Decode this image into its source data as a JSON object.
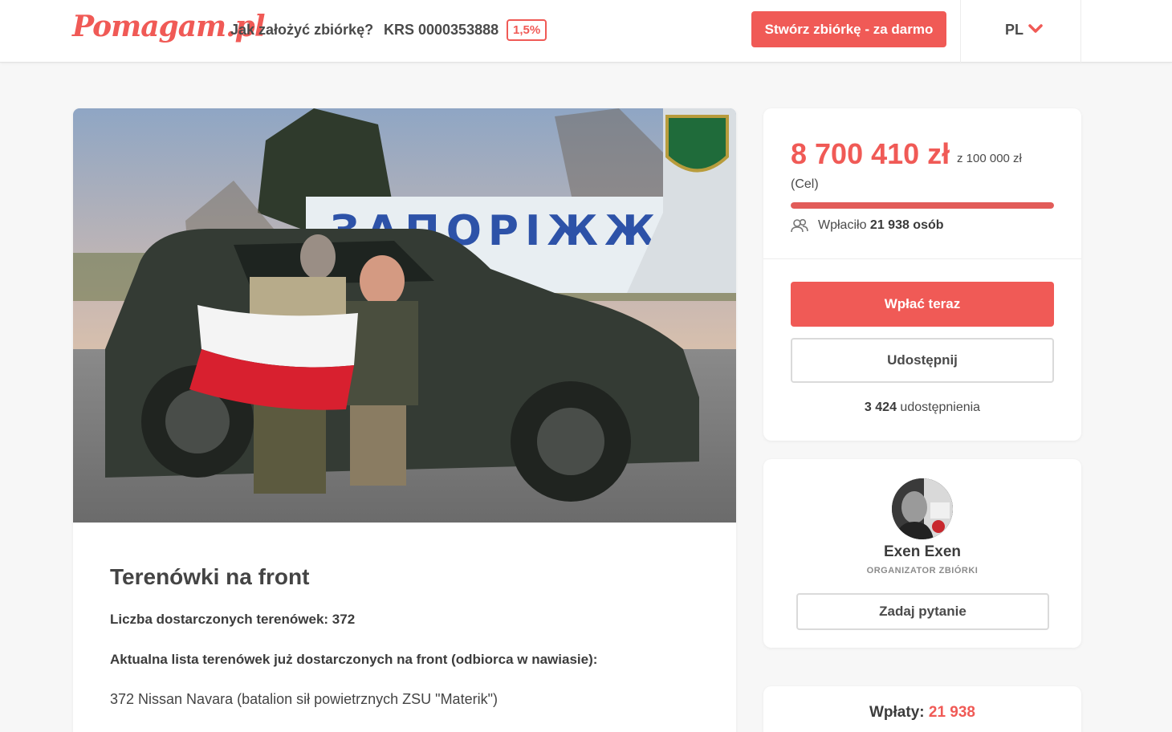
{
  "header": {
    "logo": "Pomagam.pl",
    "nav_how": "Jak założyć zbiórkę?",
    "nav_krs": "KRS 0000353888",
    "krs_badge": "1,5%",
    "create_button": "Stwórz zbiórkę - za darmo",
    "language": "PL"
  },
  "campaign": {
    "title": "Terenówki na front",
    "delivered_count": "Liczba dostarczonych terenówek: 372",
    "list_heading": "Aktualna lista terenówek już dostarczonych na front (odbiorca w nawiasie):",
    "latest_item": "372 Nissan Navara (batalion sił powietrznych ZSU \"Materik\")",
    "photo_sign_text": "ЗАПОРІЖЖЯ"
  },
  "funding": {
    "raised": "8 700 410 zł",
    "goal": "z 100 000 zł",
    "goal_label": "(Cel)",
    "progress_percent": 100,
    "donors_prefix": "Wpłaciło",
    "donors_count": "21 938 osób",
    "pay_button": "Wpłać teraz",
    "share_button": "Udostępnij",
    "shares_count": "3 424",
    "shares_label": "udostępnienia"
  },
  "organizer": {
    "name": "Exen Exen",
    "role": "ORGANIZATOR ZBIÓRKI",
    "ask_button": "Zadaj pytanie"
  },
  "payments": {
    "label": "Wpłaty:",
    "count": "21 938"
  },
  "colors": {
    "accent": "#f05a56",
    "background": "#f7f7f7"
  }
}
